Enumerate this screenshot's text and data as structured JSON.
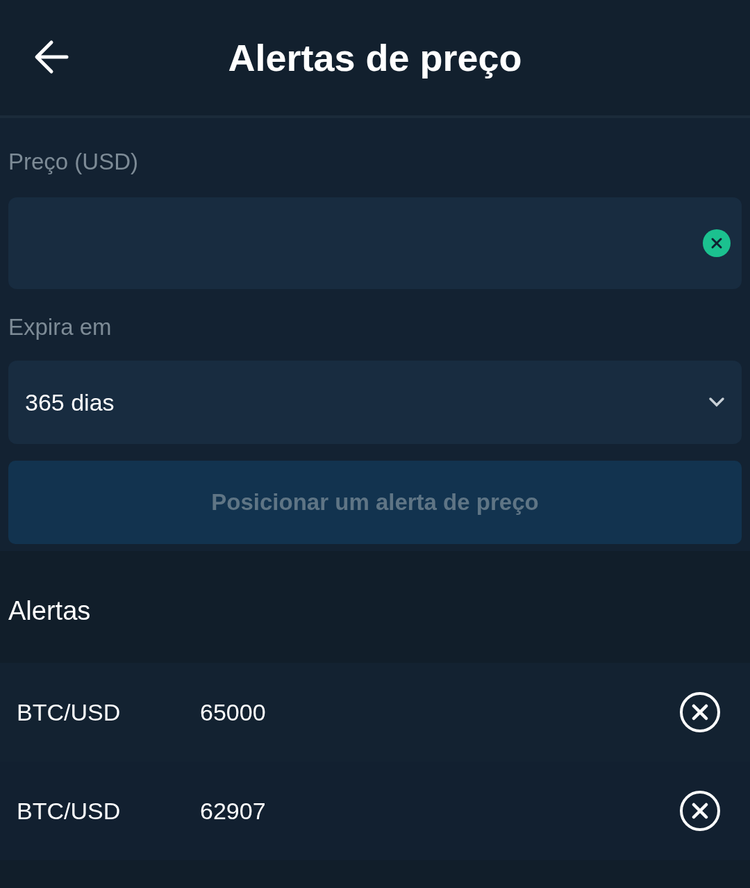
{
  "header": {
    "title": "Alertas de preço"
  },
  "price_field": {
    "label": "Preço (USD)"
  },
  "expiry_field": {
    "label": "Expira em",
    "value": "365 dias"
  },
  "submit_button": {
    "label": "Posicionar um alerta de preço",
    "disabled": true
  },
  "alerts": {
    "title": "Alertas",
    "items": [
      {
        "pair": "BTC/USD",
        "price": "65000"
      },
      {
        "pair": "BTC/USD",
        "price": "62907"
      }
    ]
  }
}
